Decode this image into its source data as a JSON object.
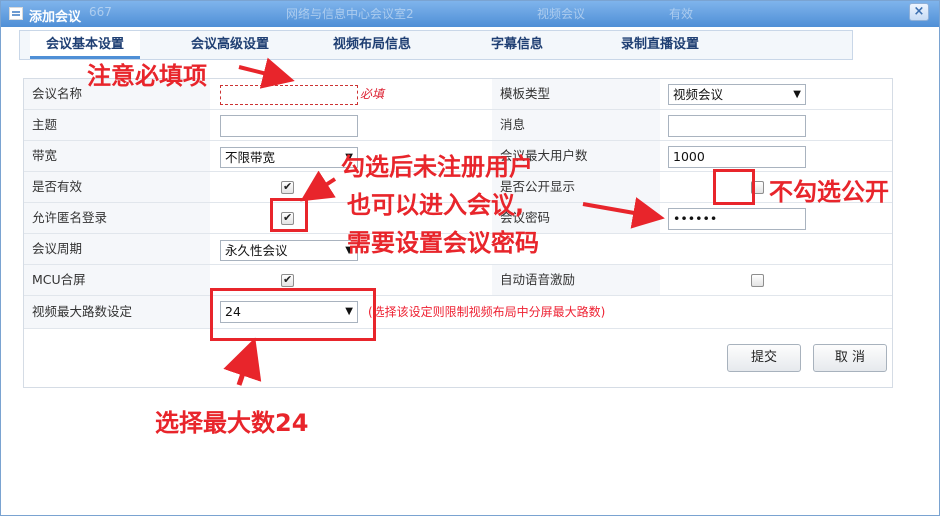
{
  "window": {
    "title": "添加会议",
    "close_icon": "×"
  },
  "background_row": {
    "c1": "667",
    "c2": "网络与信息中心会议室2",
    "c3": "视频会议",
    "c4": "有效"
  },
  "tabs": [
    {
      "label": "会议基本设置",
      "active": true
    },
    {
      "label": "会议高级设置"
    },
    {
      "label": "视频布局信息"
    },
    {
      "label": "字幕信息"
    },
    {
      "label": "录制直播设置"
    }
  ],
  "form": {
    "meeting_name": {
      "label": "会议名称",
      "value": "",
      "required": "必填"
    },
    "template_type": {
      "label": "模板类型",
      "value": "视频会议"
    },
    "subject": {
      "label": "主题",
      "value": ""
    },
    "message": {
      "label": "消息",
      "value": ""
    },
    "bandwidth": {
      "label": "带宽",
      "value": "不限带宽"
    },
    "max_users": {
      "label": "会议最大用户数",
      "value": "1000"
    },
    "is_valid": {
      "label": "是否有效",
      "checked": true
    },
    "is_public": {
      "label": "是否公开显示",
      "checked": false
    },
    "anonymous_login": {
      "label": "允许匿名登录",
      "checked": true
    },
    "meeting_password": {
      "label": "会议密码",
      "value": "••••••"
    },
    "meeting_cycle": {
      "label": "会议周期",
      "value": "永久性会议"
    },
    "mcu_composite": {
      "label": "MCU合屏",
      "checked": true
    },
    "auto_voice": {
      "label": "自动语音激励",
      "checked": false
    },
    "max_video_paths": {
      "label": "视频最大路数设定",
      "value": "24",
      "hint": "(选择该设定则限制视频布局中分屏最大路数)"
    }
  },
  "buttons": {
    "submit": "提交",
    "cancel": "取 消"
  },
  "annotations": {
    "required_note": "注意必填项",
    "anonymous_note_1": "勾选后未注册用户",
    "anonymous_note_2": "也可以进入会议,",
    "anonymous_note_3": "需要设置会议密码",
    "public_note": "不勾选公开",
    "max_note": "选择最大数24"
  },
  "colors": {
    "annotation": "#e8252b",
    "title_bar": "#4f8fd6",
    "tab_text": "#1f3f73"
  }
}
